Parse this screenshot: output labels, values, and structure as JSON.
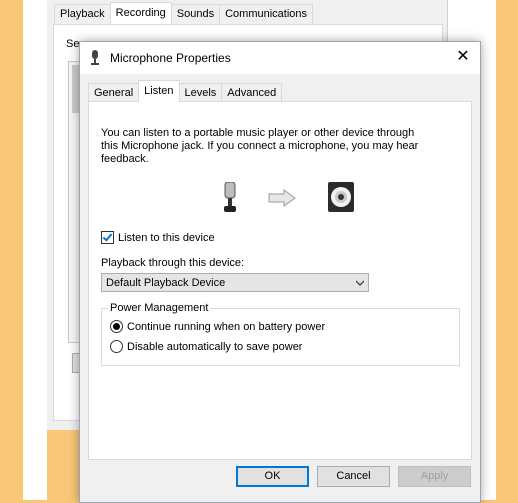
{
  "background_window": {
    "tabs": [
      "Playback",
      "Recording",
      "Sounds",
      "Communications"
    ],
    "active_tab": "Recording",
    "panel_text_fragment": "Se"
  },
  "dialog": {
    "title": "Microphone Properties",
    "close_glyph": "✕",
    "tabs": [
      "General",
      "Listen",
      "Levels",
      "Advanced"
    ],
    "active_tab": "Listen",
    "description_line1": "You can listen to a portable music player or other device through",
    "description_line2": "this Microphone jack.  If you connect a microphone, you may hear",
    "description_line3": "feedback.",
    "listen_checkbox_label": "Listen to this device",
    "listen_checked": true,
    "playback_label": "Playback through this device:",
    "playback_selected": "Default Playback Device",
    "power_group_title": "Power Management",
    "radio_continue": "Continue running when on battery power",
    "radio_disable": "Disable automatically to save power",
    "selected_power_option": "Continue running when on battery power",
    "buttons": {
      "ok": "OK",
      "cancel": "Cancel",
      "apply": "Apply"
    },
    "apply_enabled": false,
    "icons": [
      "microphone-icon",
      "arrow-right-icon",
      "speaker-icon",
      "chevron-down-icon"
    ]
  },
  "colors": {
    "desktop_background": "#F9C778",
    "accent": "#0078d7"
  }
}
